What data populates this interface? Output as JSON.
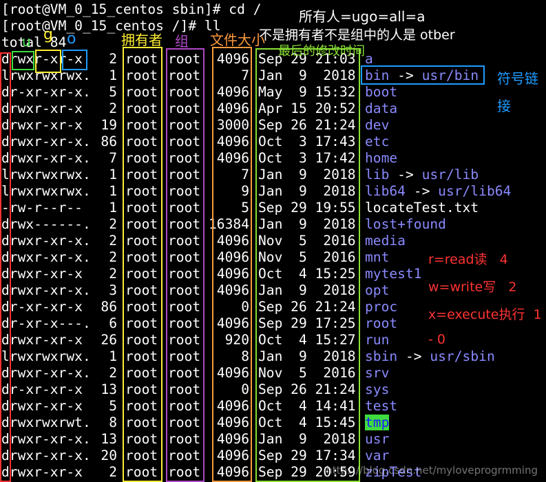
{
  "terminal": {
    "prompt1": "[root@VM_0_15_centos sbin]# cd /",
    "prompt2": "[root@VM_0_15_centos /]# ll",
    "total": "total 84",
    "rows": [
      {
        "perm": "drwxr-xr-x",
        "links": "2",
        "owner": "root",
        "group": "root",
        "size": "4096",
        "date": "Sep 29 21:03",
        "name": "a",
        "type": "dir"
      },
      {
        "perm": "lrwxrwxrwx.",
        "links": "1",
        "owner": "root",
        "group": "root",
        "size": "7",
        "date": "Jan  9  2018",
        "name": "bin",
        "link": "usr/bin",
        "type": "link"
      },
      {
        "perm": "dr-xr-xr-x.",
        "links": "5",
        "owner": "root",
        "group": "root",
        "size": "4096",
        "date": "May  9 15:32",
        "name": "boot",
        "type": "dir"
      },
      {
        "perm": "drwxr-xr-x",
        "links": "2",
        "owner": "root",
        "group": "root",
        "size": "4096",
        "date": "Apr 15 20:52",
        "name": "data",
        "type": "dir"
      },
      {
        "perm": "drwxr-xr-x",
        "links": "19",
        "owner": "root",
        "group": "root",
        "size": "3000",
        "date": "Sep 26 21:24",
        "name": "dev",
        "type": "dir"
      },
      {
        "perm": "drwxr-xr-x.",
        "links": "86",
        "owner": "root",
        "group": "root",
        "size": "4096",
        "date": "Oct  3 17:43",
        "name": "etc",
        "type": "dir"
      },
      {
        "perm": "drwxr-xr-x.",
        "links": "7",
        "owner": "root",
        "group": "root",
        "size": "4096",
        "date": "Oct  3 17:42",
        "name": "home",
        "type": "dir"
      },
      {
        "perm": "lrwxrwxrwx.",
        "links": "1",
        "owner": "root",
        "group": "root",
        "size": "7",
        "date": "Jan  9  2018",
        "name": "lib",
        "link": "usr/lib",
        "type": "link"
      },
      {
        "perm": "lrwxrwxrwx.",
        "links": "1",
        "owner": "root",
        "group": "root",
        "size": "9",
        "date": "Jan  9  2018",
        "name": "lib64",
        "link": "usr/lib64",
        "type": "link"
      },
      {
        "perm": "-rw-r--r--",
        "links": "1",
        "owner": "root",
        "group": "root",
        "size": "5",
        "date": "Sep 29 19:55",
        "name": "locateTest.txt",
        "type": "file"
      },
      {
        "perm": "drwx------.",
        "links": "2",
        "owner": "root",
        "group": "root",
        "size": "16384",
        "date": "Jan  9  2018",
        "name": "lost+found",
        "type": "dir"
      },
      {
        "perm": "drwxr-xr-x.",
        "links": "2",
        "owner": "root",
        "group": "root",
        "size": "4096",
        "date": "Nov  5  2016",
        "name": "media",
        "type": "dir"
      },
      {
        "perm": "drwxr-xr-x.",
        "links": "2",
        "owner": "root",
        "group": "root",
        "size": "4096",
        "date": "Nov  5  2016",
        "name": "mnt",
        "type": "dir"
      },
      {
        "perm": "drwxr-xr-x",
        "links": "2",
        "owner": "root",
        "group": "root",
        "size": "4096",
        "date": "Oct  4 15:25",
        "name": "mytest1",
        "type": "dir"
      },
      {
        "perm": "drwxr-xr-x.",
        "links": "3",
        "owner": "root",
        "group": "root",
        "size": "4096",
        "date": "Jan  9  2018",
        "name": "opt",
        "type": "dir"
      },
      {
        "perm": "dr-xr-xr-x",
        "links": "86",
        "owner": "root",
        "group": "root",
        "size": "0",
        "date": "Sep 26 21:24",
        "name": "proc",
        "type": "dir"
      },
      {
        "perm": "dr-xr-x---.",
        "links": "6",
        "owner": "root",
        "group": "root",
        "size": "4096",
        "date": "Sep 29 17:25",
        "name": "root",
        "type": "dir"
      },
      {
        "perm": "drwxr-xr-x",
        "links": "26",
        "owner": "root",
        "group": "root",
        "size": "920",
        "date": "Oct  4 15:27",
        "name": "run",
        "type": "dir"
      },
      {
        "perm": "lrwxrwxrwx.",
        "links": "1",
        "owner": "root",
        "group": "root",
        "size": "8",
        "date": "Jan  9  2018",
        "name": "sbin",
        "link": "usr/sbin",
        "type": "link"
      },
      {
        "perm": "drwxr-xr-x.",
        "links": "2",
        "owner": "root",
        "group": "root",
        "size": "4096",
        "date": "Nov  5  2016",
        "name": "srv",
        "type": "dir"
      },
      {
        "perm": "dr-xr-xr-x",
        "links": "13",
        "owner": "root",
        "group": "root",
        "size": "0",
        "date": "Sep 26 21:24",
        "name": "sys",
        "type": "dir"
      },
      {
        "perm": "drwxr-xr-x",
        "links": "5",
        "owner": "root",
        "group": "root",
        "size": "4096",
        "date": "Oct  4 14:41",
        "name": "test",
        "type": "dir"
      },
      {
        "perm": "drwxrwxrwt.",
        "links": "8",
        "owner": "root",
        "group": "root",
        "size": "4096",
        "date": "Oct  4 15:45",
        "name": "tmp",
        "type": "tmp"
      },
      {
        "perm": "drwxr-xr-x.",
        "links": "13",
        "owner": "root",
        "group": "root",
        "size": "4096",
        "date": "Jan  9  2018",
        "name": "usr",
        "type": "dir"
      },
      {
        "perm": "drwxr-xr-x.",
        "links": "20",
        "owner": "root",
        "group": "root",
        "size": "4096",
        "date": "Sep 29 17:34",
        "name": "var",
        "type": "dir"
      },
      {
        "perm": "drwxr-xr-x",
        "links": "2",
        "owner": "root",
        "group": "root",
        "size": "4096",
        "date": "Sep 29 20:59",
        "name": "zipTest",
        "type": "dir"
      }
    ]
  },
  "annotations": {
    "u": "u",
    "g": "g",
    "o": "o",
    "owner_label": "拥有者",
    "group_label": "组",
    "size_label": "文件大小",
    "mtime_label": "最后的修改时间",
    "all_label": "所有人=ugo=all=a",
    "other_label": "不是拥有者不是组中的人是 otber",
    "symlink_label": "符号链接",
    "r_label": "r=read读   4",
    "w_label": "w=write写   2",
    "x_label": "x=execute执行  1",
    "dash_label": "- 0"
  },
  "watermark": "https://blog.csdn.net/myloveprogrmming",
  "colors": {
    "dir": "#8a8aff",
    "tmp_bg": "#3fdc3f",
    "red": "#ff3333",
    "yellow": "#ffee33",
    "green": "#3fdc3f",
    "blue": "#1e9cff",
    "purple": "#b048c8",
    "orange": "#ff9a3c",
    "lime": "#8ae034"
  }
}
